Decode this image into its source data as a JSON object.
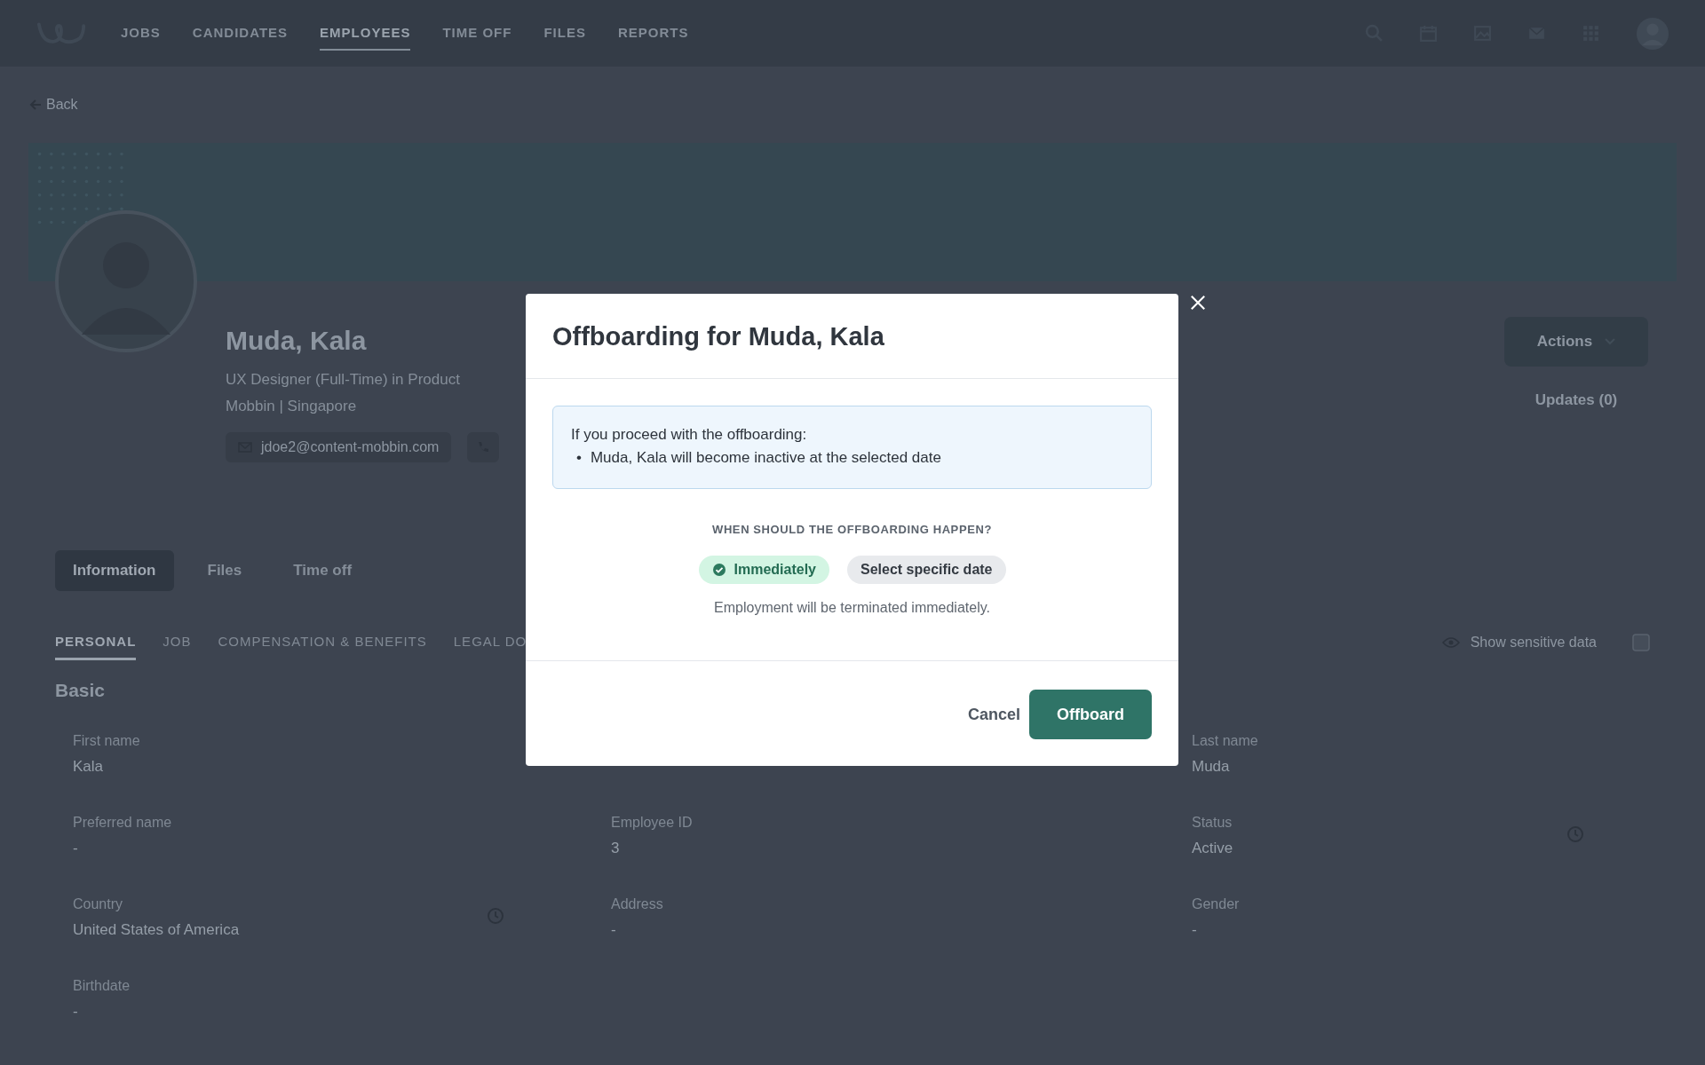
{
  "nav": {
    "items": [
      {
        "label": "JOBS",
        "selected": false
      },
      {
        "label": "CANDIDATES",
        "selected": false
      },
      {
        "label": "EMPLOYEES",
        "selected": true
      },
      {
        "label": "TIME OFF",
        "selected": false
      },
      {
        "label": "FILES",
        "selected": false
      },
      {
        "label": "REPORTS",
        "selected": false
      }
    ]
  },
  "back": "Back",
  "profile": {
    "name": "Muda, Kala",
    "title": "UX Designer (Full-Time) in Product",
    "location": "Mobbin | Singapore",
    "email": "jdoe2@content-mobbin.com"
  },
  "actions": "Actions",
  "updates": "Updates (0)",
  "tabs": [
    {
      "label": "Information",
      "selected": true
    },
    {
      "label": "Files",
      "selected": false
    },
    {
      "label": "Time off",
      "selected": false
    }
  ],
  "subtabs": [
    {
      "label": "PERSONAL",
      "selected": true
    },
    {
      "label": "JOB",
      "selected": false
    },
    {
      "label": "COMPENSATION & BENEFITS",
      "selected": false
    },
    {
      "label": "LEGAL DO",
      "selected": false
    }
  ],
  "sensitive": "Show sensitive data",
  "section": "Basic",
  "field_columns": [
    [
      {
        "label": "First name",
        "value": "Kala",
        "history": false
      },
      {
        "label": "Preferred name",
        "value": "-",
        "history": false
      },
      {
        "label": "Country",
        "value": "United States of America",
        "history": true
      },
      {
        "label": "Birthdate",
        "value": "-",
        "history": false
      }
    ],
    [
      {
        "label": "Employee ID",
        "value": "3",
        "history": false
      },
      {
        "label": "Address",
        "value": "-",
        "history": false
      }
    ],
    [
      {
        "label": "Last name",
        "value": "Muda",
        "history": false
      },
      {
        "label": "Status",
        "value": "Active",
        "history": true
      },
      {
        "label": "Gender",
        "value": "-",
        "history": false
      }
    ]
  ],
  "modal": {
    "title": "Offboarding for Muda, Kala",
    "notice": {
      "intro": "If you proceed with the offboarding:",
      "bullets": [
        {
          "marker": "•",
          "text": "Muda, Kala will become inactive at the selected date"
        }
      ]
    },
    "question": "WHEN SHOULD THE OFFBOARDING HAPPEN?",
    "options": [
      {
        "label": "Immediately",
        "selected": true
      },
      {
        "label": "Select specific date",
        "selected": false
      }
    ],
    "hint": "Employment will be terminated immediately.",
    "cancel": "Cancel",
    "confirm": "Offboard"
  }
}
